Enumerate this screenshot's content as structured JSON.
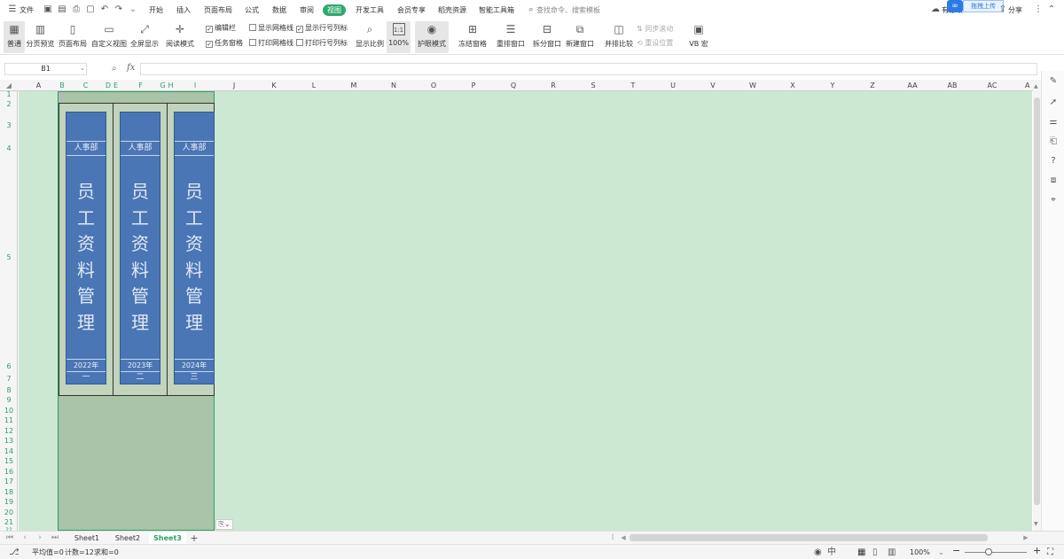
{
  "menubar": {
    "file": "文件",
    "tabs": [
      "开始",
      "插入",
      "页面布局",
      "公式",
      "数据",
      "审阅",
      "视图",
      "开发工具",
      "会员专享",
      "稻壳资源",
      "智能工具箱"
    ],
    "active_tab": "视图",
    "search_placeholder": "查找命令、搜索模板",
    "cloud_label": "有修改",
    "upload_label": "拖拽上传",
    "share_label": "分享"
  },
  "ribbon": {
    "normal": "普通",
    "page_break": "分页预览",
    "page_layout": "页面布局",
    "custom_view": "自定义视图",
    "full_screen": "全屏显示",
    "reading_mode": "阅读模式",
    "edit_bar": "编辑栏",
    "task_pane": "任务窗格",
    "show_gridlines": "显示网格线",
    "print_gridlines": "打印网格线",
    "show_headers": "显示行号列标",
    "print_headers": "打印行号列标",
    "zoom": "显示比例",
    "zoom_100": "100%",
    "eye_mode": "护眼模式",
    "freeze": "冻结窗格",
    "arrange": "重排窗口",
    "split": "拆分窗口",
    "new_window": "新建窗口",
    "side_by_side": "并排比较",
    "sync_scroll": "同步滚动",
    "reset_position": "重设位置",
    "vb_macro": "VB 宏"
  },
  "formula": {
    "name_box": "B1",
    "fx": "fx",
    "value": ""
  },
  "columns": [
    "A",
    "B",
    "C",
    "D",
    "E",
    "F",
    "G",
    "H",
    "I",
    "J",
    "K",
    "L",
    "M",
    "N",
    "O",
    "P",
    "Q",
    "R",
    "S",
    "T",
    "U",
    "V",
    "W",
    "X",
    "Y",
    "Z",
    "AA",
    "AB",
    "AC",
    "A"
  ],
  "rows": [
    "1",
    "2",
    "3",
    "4",
    "5",
    "6",
    "7",
    "8",
    "9",
    "10",
    "11",
    "12",
    "13",
    "14",
    "15",
    "16",
    "17",
    "18",
    "19",
    "20",
    "21",
    "22"
  ],
  "books": [
    {
      "dept": "人事部",
      "title": [
        "员",
        "工",
        "资",
        "料",
        "管",
        "理"
      ],
      "year": "2022年",
      "seq": "一"
    },
    {
      "dept": "人事部",
      "title": [
        "员",
        "工",
        "资",
        "料",
        "管",
        "理"
      ],
      "year": "2023年",
      "seq": "二"
    },
    {
      "dept": "人事部",
      "title": [
        "员",
        "工",
        "资",
        "料",
        "管",
        "理"
      ],
      "year": "2024年",
      "seq": "三"
    }
  ],
  "sheets": [
    "Sheet1",
    "Sheet2",
    "Sheet3"
  ],
  "active_sheet": "Sheet3",
  "status": {
    "average": "平均值=0",
    "count": "计数=12",
    "sum": "求和=0",
    "zoom": "100%"
  },
  "colors": {
    "accent": "#2c9f66",
    "grid_bg": "#cde8d2",
    "book_blue": "#4a76b5",
    "shelf": "#c2d4bc"
  },
  "icons": [
    "menu-icon",
    "save-icon",
    "print-icon",
    "undo-icon",
    "redo-icon",
    "search-icon",
    "cloud-icon",
    "share-icon",
    "zoom-icon",
    "fx-icon",
    "eye-icon"
  ]
}
